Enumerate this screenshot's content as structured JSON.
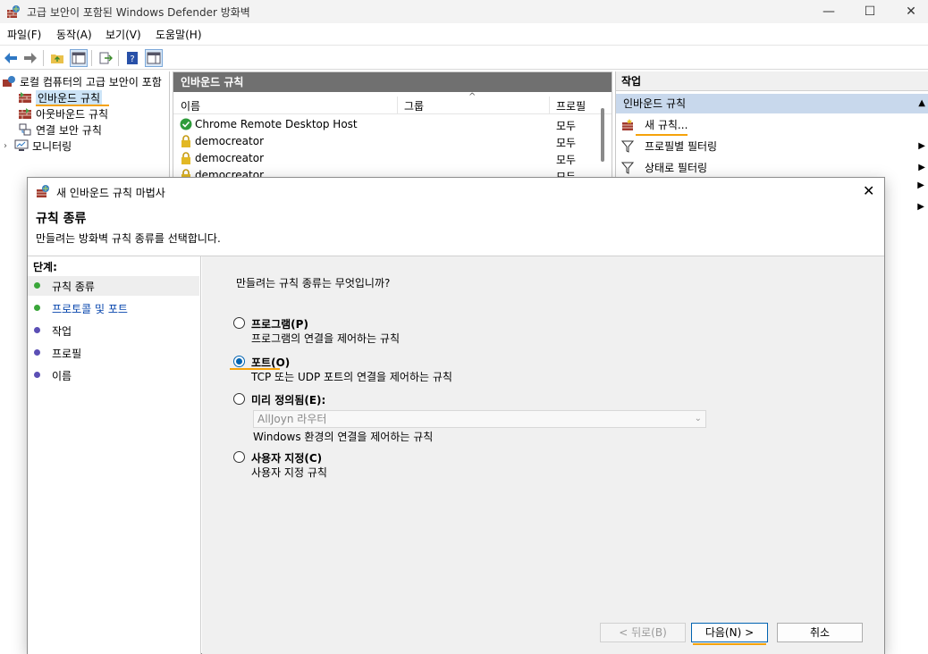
{
  "window": {
    "title": "고급 보안이 포함된 Windows Defender 방화벽",
    "min": "—",
    "max": "☐",
    "close": "✕"
  },
  "menu": [
    "파일(F)",
    "동작(A)",
    "보기(V)",
    "도움말(H)"
  ],
  "tree": {
    "root": "로컬 컴퓨터의 고급 보안이 포함",
    "items": [
      "인바운드 규칙",
      "아웃바운드 규칙",
      "연결 보안 규칙",
      "모니터링"
    ]
  },
  "center": {
    "header": "인바운드 규칙",
    "columns": [
      "이름",
      "그룹",
      "프로필"
    ],
    "rows": [
      {
        "name": "Chrome Remote Desktop Host",
        "profile": "모두",
        "icon": "check-shield-icon"
      },
      {
        "name": "democreator",
        "profile": "모두",
        "icon": "lock-icon"
      },
      {
        "name": "democreator",
        "profile": "모두",
        "icon": "lock-icon"
      },
      {
        "name": "democreator",
        "profile": "모두",
        "icon": "lock-icon"
      }
    ]
  },
  "actions": {
    "header": "작업",
    "sub": "인바운드 규칙",
    "items": [
      "새 규칙...",
      "프로필별 필터링",
      "상태로 필터링"
    ]
  },
  "wizard": {
    "title": "새 인바운드 규칙 마법사",
    "close": "✕",
    "heading": "규칙 종류",
    "subheading": "만들려는 방화벽 규칙 종류를 선택합니다.",
    "steps_header": "단계:",
    "steps": [
      "규칙 종류",
      "프로토콜 및 포트",
      "작업",
      "프로필",
      "이름"
    ],
    "question": "만들려는 규칙 종류는 무엇입니까?",
    "options": [
      {
        "label": "프로그램(P)",
        "desc": "프로그램의 연결을 제어하는 규칙",
        "checked": false
      },
      {
        "label": "포트(O)",
        "desc": "TCP 또는 UDP 포트의 연결을 제어하는 규칙",
        "checked": true
      },
      {
        "label": "미리 정의됨(E):",
        "desc": "Windows 환경의 연결을 제어하는 규칙",
        "checked": false
      },
      {
        "label": "사용자 지정(C)",
        "desc": "사용자 지정 규칙",
        "checked": false
      }
    ],
    "predefined_value": "AllJoyn 라우터",
    "buttons": {
      "back": "< 뒤로(B)",
      "next": "다음(N) >",
      "cancel": "취소"
    }
  },
  "colors": {
    "accent": "#0063b1",
    "highlight": "#f5a20a",
    "step_dot_green": "#3aa63a",
    "step_dot_purple": "#5b4fb5"
  }
}
